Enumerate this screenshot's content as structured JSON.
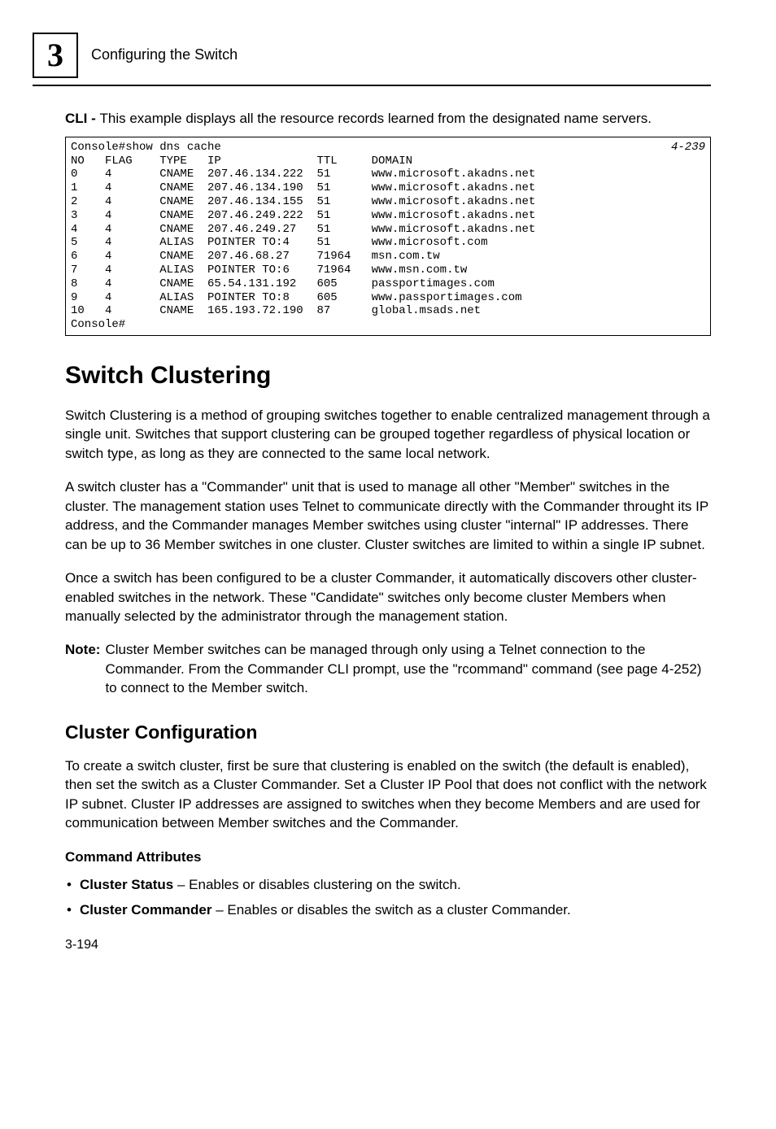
{
  "header": {
    "chapter_number": "3",
    "title": "Configuring the Switch"
  },
  "cli_intro": {
    "bold": "CLI - ",
    "text": "This example displays all the resource records learned from the designated name servers."
  },
  "console": {
    "first_left": "Console#show dns cache",
    "first_right": "4-239",
    "header_row": "NO   FLAG    TYPE   IP              TTL     DOMAIN",
    "rows": [
      "0    4       CNAME  207.46.134.222  51      www.microsoft.akadns.net",
      "1    4       CNAME  207.46.134.190  51      www.microsoft.akadns.net",
      "2    4       CNAME  207.46.134.155  51      www.microsoft.akadns.net",
      "3    4       CNAME  207.46.249.222  51      www.microsoft.akadns.net",
      "4    4       CNAME  207.46.249.27   51      www.microsoft.akadns.net",
      "5    4       ALIAS  POINTER TO:4    51      www.microsoft.com",
      "6    4       CNAME  207.46.68.27    71964   msn.com.tw",
      "7    4       ALIAS  POINTER TO:6    71964   www.msn.com.tw",
      "8    4       CNAME  65.54.131.192   605     passportimages.com",
      "9    4       ALIAS  POINTER TO:8    605     www.passportimages.com",
      "10   4       CNAME  165.193.72.190  87      global.msads.net"
    ],
    "last": "Console#"
  },
  "sections": {
    "h1": "Switch Clustering",
    "p1": "Switch Clustering is a method of grouping switches together to enable centralized management through a single unit. Switches that support clustering can be grouped together regardless of physical location or switch type, as long as they are connected to the same local network.",
    "p2": "A switch cluster has a \"Commander\" unit that is used to manage all other \"Member\" switches in the cluster. The management station uses Telnet to communicate directly with the Commander throught its IP address, and the Commander manages Member switches using cluster \"internal\" IP addresses. There can be up to 36 Member switches in one cluster. Cluster switches are limited to within a single IP subnet.",
    "p3": "Once a switch has been configured to be a cluster Commander, it automatically discovers other cluster-enabled switches in the network. These \"Candidate\" switches only become cluster Members when manually selected by the administrator through the management station.",
    "note_label": "Note:",
    "note_text": "Cluster Member switches can be managed through only using a Telnet connection to the Commander. From the Commander CLI prompt, use the \"rcommand\" command (see page 4-252) to connect to the Member switch.",
    "h2": "Cluster Configuration",
    "p4": "To create a switch cluster, first be sure that clustering is enabled on the switch (the default is enabled), then set the switch as a Cluster Commander. Set a Cluster IP Pool that does not conflict with the network IP subnet. Cluster IP addresses are assigned to switches when they become Members and are used for communication between Member switches and the Commander.",
    "attr_head": "Command Attributes",
    "attrs": [
      {
        "bold": "Cluster Status",
        "rest": " – Enables or disables clustering on the switch."
      },
      {
        "bold": "Cluster Commander",
        "rest": " – Enables or disables the switch as a cluster Commander."
      }
    ]
  },
  "footer": "3-194"
}
